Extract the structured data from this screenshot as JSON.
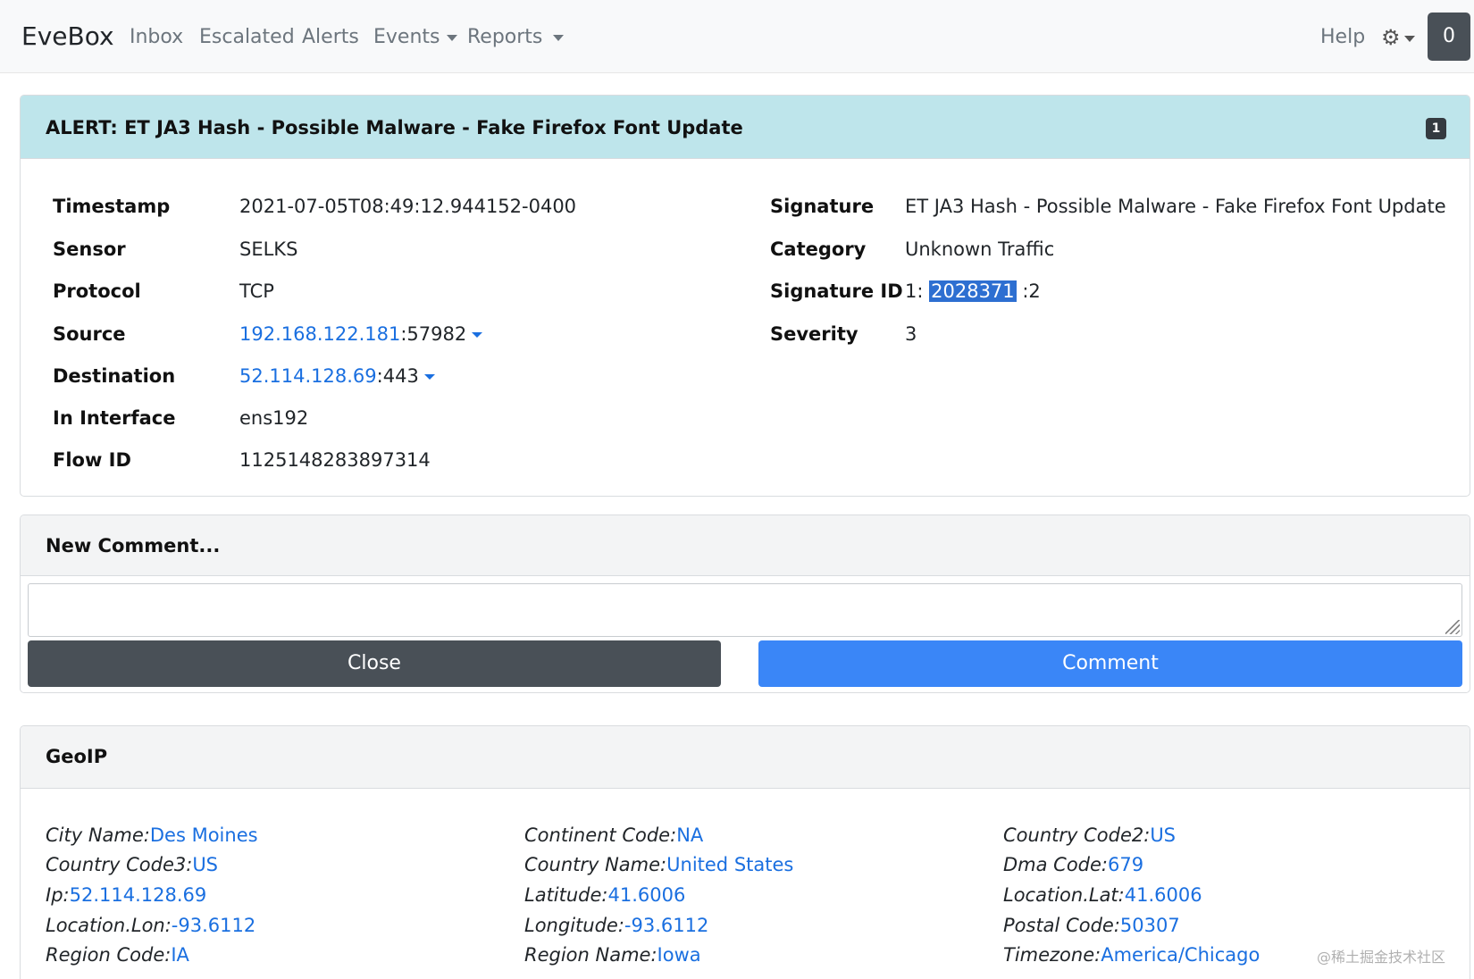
{
  "nav": {
    "brand": "EveBox",
    "items": [
      "Inbox",
      "Escalated",
      "Alerts",
      "Events",
      "Reports"
    ],
    "help": "Help",
    "count": "0"
  },
  "alert": {
    "title": "ALERT: ET JA3 Hash - Possible Malware - Fake Firefox Font Update",
    "badge": "1",
    "left": [
      {
        "label": "Timestamp",
        "value": "2021-07-05T08:49:12.944152-0400"
      },
      {
        "label": "Sensor",
        "value": "SELKS"
      },
      {
        "label": "Protocol",
        "value": "TCP"
      },
      {
        "label": "Source",
        "value": "192.168.122.181",
        "port": ":57982"
      },
      {
        "label": "Destination",
        "value": "52.114.128.69",
        "port": ":443"
      },
      {
        "label": "In Interface",
        "value": "ens192"
      },
      {
        "label": "Flow ID",
        "value": "1125148283897314"
      }
    ],
    "right": [
      {
        "label": "Signature",
        "value": "ET JA3 Hash - Possible Malware - Fake Firefox Font Update"
      },
      {
        "label": "Category",
        "value": "Unknown Traffic"
      },
      {
        "label": "Signature ID",
        "prefix": "1:",
        "value": "2028371",
        "suffix": ":2"
      },
      {
        "label": "Severity",
        "value": "3"
      }
    ]
  },
  "comment": {
    "title": "New Comment...",
    "close_label": "Close",
    "comment_label": "Comment"
  },
  "geoip": {
    "title": "GeoIP",
    "items": [
      {
        "label": "City Name:",
        "value": "Des Moines"
      },
      {
        "label": "Continent Code:",
        "value": "NA"
      },
      {
        "label": "Country Code2:",
        "value": "US"
      },
      {
        "label": "Country Code3:",
        "value": "US"
      },
      {
        "label": "Country Name:",
        "value": "United States"
      },
      {
        "label": "Dma Code:",
        "value": "679"
      },
      {
        "label": "Ip:",
        "value": "52.114.128.69"
      },
      {
        "label": "Latitude:",
        "value": "41.6006"
      },
      {
        "label": "Location.Lat:",
        "value": "41.6006"
      },
      {
        "label": "Location.Lon:",
        "value": "-93.6112"
      },
      {
        "label": "Longitude:",
        "value": "-93.6112"
      },
      {
        "label": "Postal Code:",
        "value": "50307"
      },
      {
        "label": "Region Code:",
        "value": "IA"
      },
      {
        "label": "Region Name:",
        "value": "Iowa"
      },
      {
        "label": "Timezone:",
        "value": "America/Chicago"
      }
    ]
  },
  "watermark": "@稀土掘金技术社区",
  "colors": {
    "link": "#1a6fe0",
    "header_info": "#bee5eb",
    "btn_dark": "#495057",
    "btn_primary": "#3a86f7"
  }
}
